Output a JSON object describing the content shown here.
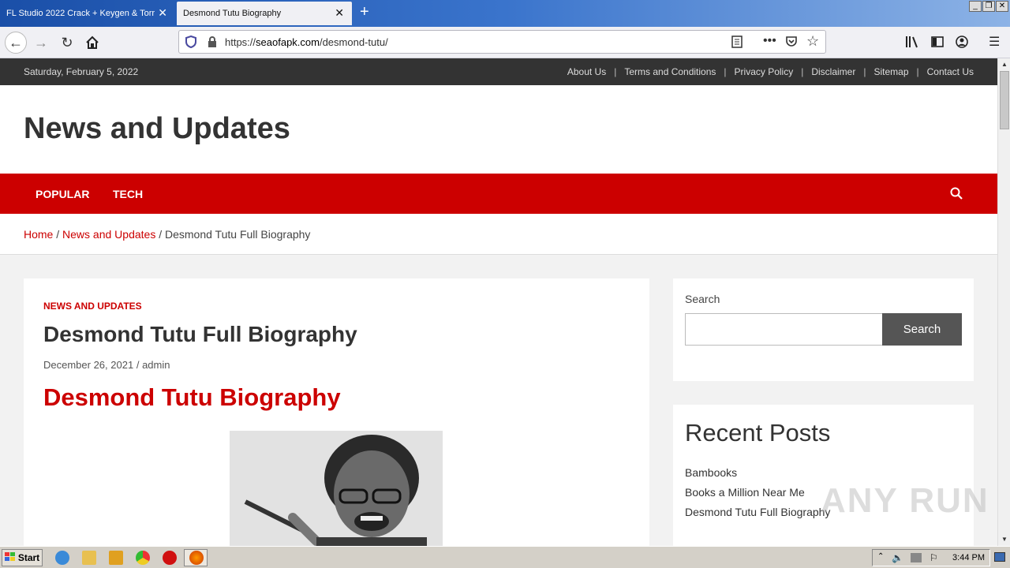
{
  "browser": {
    "tabs": [
      {
        "title": "FL Studio 2022 Crack + Keygen & Torr",
        "active": false
      },
      {
        "title": "Desmond Tutu Biography",
        "active": true
      }
    ],
    "url_prefix": "https://",
    "url_domain": "seaofapk.com",
    "url_path": "/desmond-tutu/"
  },
  "site": {
    "date": "Saturday, February 5, 2022",
    "top_links": [
      "About Us",
      "Terms and Conditions",
      "Privacy Policy",
      "Disclaimer",
      "Sitemap",
      "Contact Us"
    ],
    "separator": "|",
    "title": "News and Updates",
    "nav": [
      "POPULAR",
      "TECH"
    ],
    "breadcrumb": {
      "home": "Home",
      "section": "News and Updates",
      "current": "Desmond Tutu Full Biography",
      "sep": "/"
    }
  },
  "article": {
    "category": "NEWS AND UPDATES",
    "title": "Desmond Tutu Full Biography",
    "date": "December 26, 2021",
    "meta_sep": "/",
    "author": "admin",
    "heading": "Desmond Tutu Biography"
  },
  "sidebar": {
    "search_label": "Search",
    "search_value": "",
    "search_button": "Search",
    "recent_title": "Recent Posts",
    "recent_posts": [
      "Bambooks",
      "Books a Million Near Me",
      "Desmond Tutu Full Biography"
    ]
  },
  "watermark": "ANY RUN",
  "taskbar": {
    "start": "Start",
    "clock": "3:44 PM"
  },
  "colors": {
    "accent": "#cc0000",
    "topbar": "#333333"
  }
}
